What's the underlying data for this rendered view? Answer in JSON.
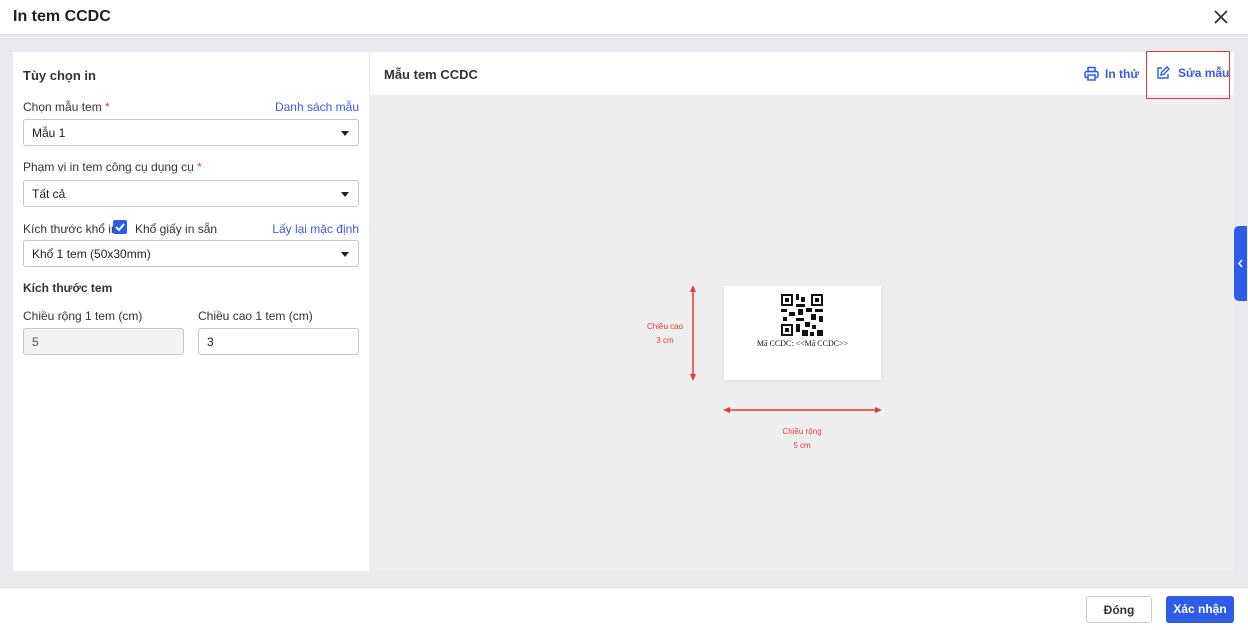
{
  "dialog": {
    "title": "In tem CCDC"
  },
  "left": {
    "heading": "Tùy chọn in",
    "template_label": "Chọn mẫu tem",
    "required": "*",
    "template_list_link": "Danh sách mẫu",
    "template_value": "Mẫu 1",
    "scope_label": "Phạm vi in tem công cụ dụng cụ",
    "scope_value": "Tất cả",
    "paper_label": "Kích thước khổ in",
    "preset_paper_label": "Khổ giấy in sẵn",
    "preset_paper_checked": true,
    "reset_link": "Lấy lại mặc định",
    "paper_value": "Khổ 1 tem (50x30mm)",
    "size_heading": "Kích thước tem",
    "width_label": "Chiều rộng 1 tem (cm)",
    "width_value": "5",
    "height_label": "Chiều cao 1 tem (cm)",
    "height_value": "3"
  },
  "right": {
    "heading": "Mẫu tem CCDC",
    "print_test": "In thử",
    "edit_template": "Sửa mẫu",
    "preview": {
      "code_text": "Mã CCDC: <<Mã CCDC>>",
      "height_label": "Chiều cao",
      "height_dim": "3 cm",
      "width_label": "Chiều rộng",
      "width_dim": "5 cm"
    }
  },
  "footer": {
    "close": "Đóng",
    "confirm": "Xác nhận"
  },
  "colors": {
    "accent": "#2f5ce6",
    "dimension": "#e53935"
  }
}
